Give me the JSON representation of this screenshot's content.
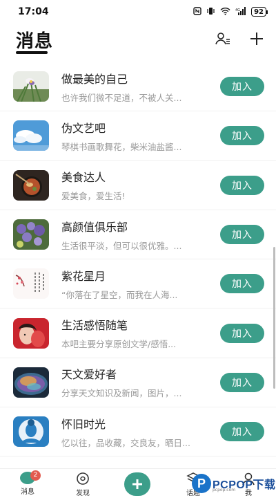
{
  "status_bar": {
    "time": "17:04",
    "battery": "92"
  },
  "header": {
    "title": "消息"
  },
  "groups": [
    {
      "name": "做最美的自己",
      "desc": "也许我们微不足道，不被人关...",
      "action": "加入",
      "avatar": "iris-flower"
    },
    {
      "name": "伪文艺吧",
      "desc": "琴棋书画歌舞花，柴米油盐酱...",
      "action": "加入",
      "avatar": "blue-sky-clouds"
    },
    {
      "name": "美食达人",
      "desc": "爱美食，爱生活!",
      "action": "加入",
      "avatar": "food-bowl"
    },
    {
      "name": "高颜值俱乐部",
      "desc": "生活很平淡，但可以很优雅。...",
      "action": "加入",
      "avatar": "purple-flowers"
    },
    {
      "name": "紫花星月",
      "desc": "“你落在了星空，而我在人海...",
      "action": "加入",
      "avatar": "calligraphy-painting"
    },
    {
      "name": "生活感悟随笔",
      "desc": "本吧主要分享原创文学/感悟...",
      "action": "加入",
      "avatar": "portrait-red"
    },
    {
      "name": "天文爱好者",
      "desc": "分享天文知识及新闻，图片，...",
      "action": "加入",
      "avatar": "cosmic-bubble"
    },
    {
      "name": "怀旧时光",
      "desc": "忆以往，品收藏，交良友，晒日...",
      "action": "加入",
      "avatar": "vintage-portrait"
    }
  ],
  "tabbar": {
    "messages": "消息",
    "messages_badge": "2",
    "discover": "发现",
    "topics": "话题",
    "me": "我"
  },
  "watermark": {
    "text": "PCPOP下载",
    "sub": "pcpop.com"
  },
  "colors": {
    "accent": "#3c9e8a",
    "badge": "#e25b4f"
  }
}
